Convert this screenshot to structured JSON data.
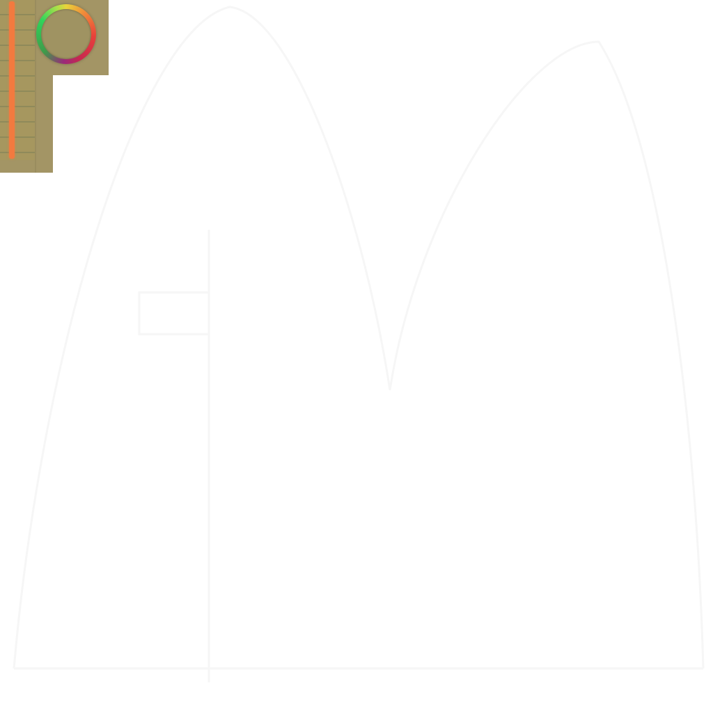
{
  "canvas": {
    "background": "#ffffff"
  },
  "color_picker": {
    "panel_color": "#a39565",
    "slider_color": "#f27a3f",
    "hue_ring": {
      "colors": [
        "#e8d43a",
        "#f08a3a",
        "#e8403a",
        "#c8284f",
        "#9a2a7a",
        "#3f9a4a",
        "#2fd45a",
        "#a8e04a"
      ]
    },
    "swatch_rows": 10,
    "icons": {
      "hue_ring": "color-wheel-icon",
      "slider": "value-slider-icon"
    }
  }
}
